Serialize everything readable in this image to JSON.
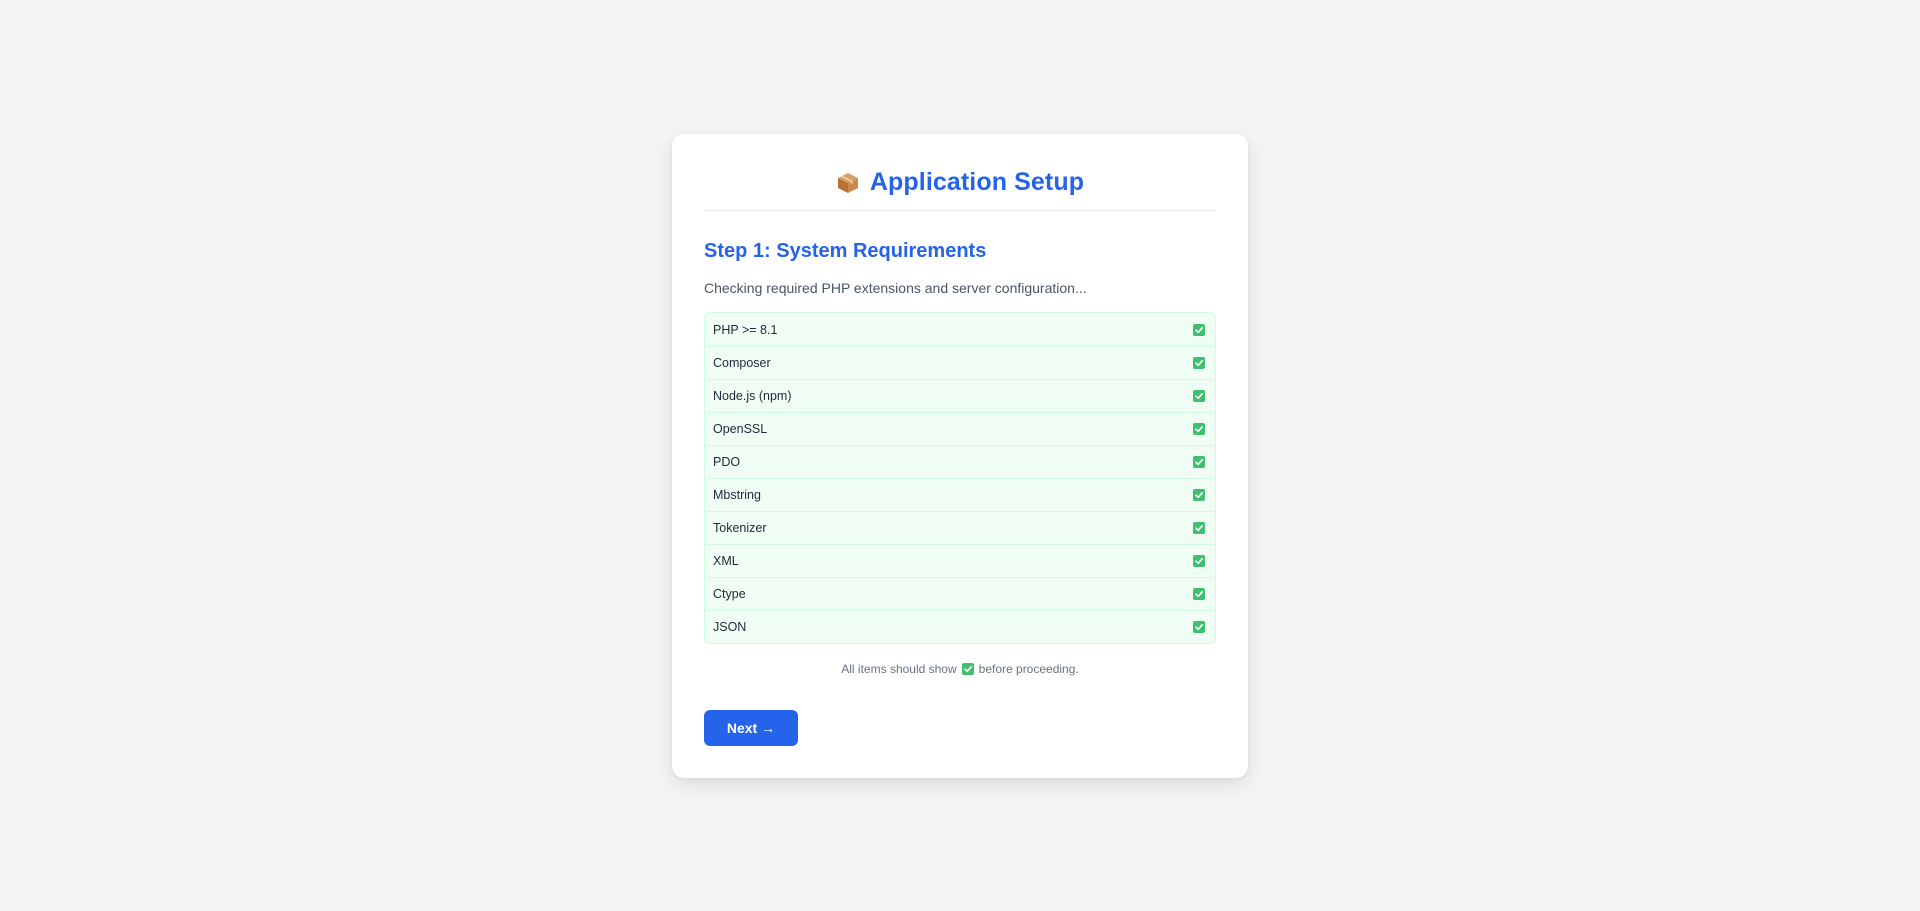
{
  "header": {
    "title": "Application Setup",
    "icon": "package-box-icon"
  },
  "step": {
    "title": "Step 1: System Requirements",
    "description": "Checking required PHP extensions and server configuration..."
  },
  "requirements": [
    {
      "label": "PHP >= 8.1",
      "status": "ok"
    },
    {
      "label": "Composer",
      "status": "ok"
    },
    {
      "label": "Node.js (npm)",
      "status": "ok"
    },
    {
      "label": "OpenSSL",
      "status": "ok"
    },
    {
      "label": "PDO",
      "status": "ok"
    },
    {
      "label": "Mbstring",
      "status": "ok"
    },
    {
      "label": "Tokenizer",
      "status": "ok"
    },
    {
      "label": "XML",
      "status": "ok"
    },
    {
      "label": "Ctype",
      "status": "ok"
    },
    {
      "label": "JSON",
      "status": "ok"
    }
  ],
  "note": {
    "before": "All items should show",
    "after": "before proceeding."
  },
  "actions": {
    "next_label": "Next →"
  },
  "colors": {
    "accent": "#2563eb",
    "success": "#3fbf6f",
    "list_bg": "#f0fdf4",
    "page_bg": "#f3f4f6"
  }
}
